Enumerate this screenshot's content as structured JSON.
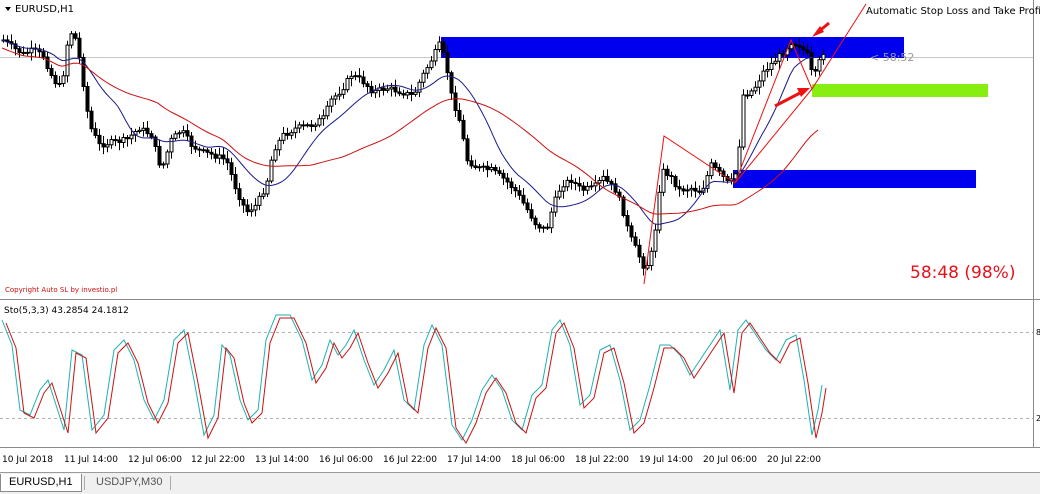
{
  "window": {
    "symbol_label": "EURUSD,H1",
    "indicator_title": "Automatic Stop Loss and Take Profit☺",
    "copyright": "Copyright Auto SL by investio.pl",
    "stats_text": "58:48 (98%)",
    "price_label": "< 58:52"
  },
  "subwindow": {
    "label": "Sto(5,3,3) 43.2854 24.1812",
    "level_high": "8",
    "level_low": "2"
  },
  "x_axis": {
    "labels": [
      "10 Jul 2018",
      "11 Jul 14:00",
      "12 Jul 06:00",
      "12 Jul 22:00",
      "13 Jul 14:00",
      "16 Jul 06:00",
      "16 Jul 22:00",
      "17 Jul 14:00",
      "18 Jul 06:00",
      "18 Jul 22:00",
      "19 Jul 14:00",
      "20 Jul 06:00",
      "20 Jul 22:00"
    ]
  },
  "tabs": [
    {
      "label": "EURUSD,H1",
      "active": true
    },
    {
      "label": "USDJPY,M30",
      "active": false
    }
  ],
  "colors": {
    "bull_candle": "#000000",
    "bear_candle": "#000000",
    "ma_fast": "#1a1a8c",
    "ma_slow": "#cc1111",
    "zone_blue": "#0000ee",
    "zone_green": "#88ee11",
    "arrow_red": "#ee1111",
    "stoch_main": "#20b0b0",
    "stoch_signal": "#cc1111"
  }
}
